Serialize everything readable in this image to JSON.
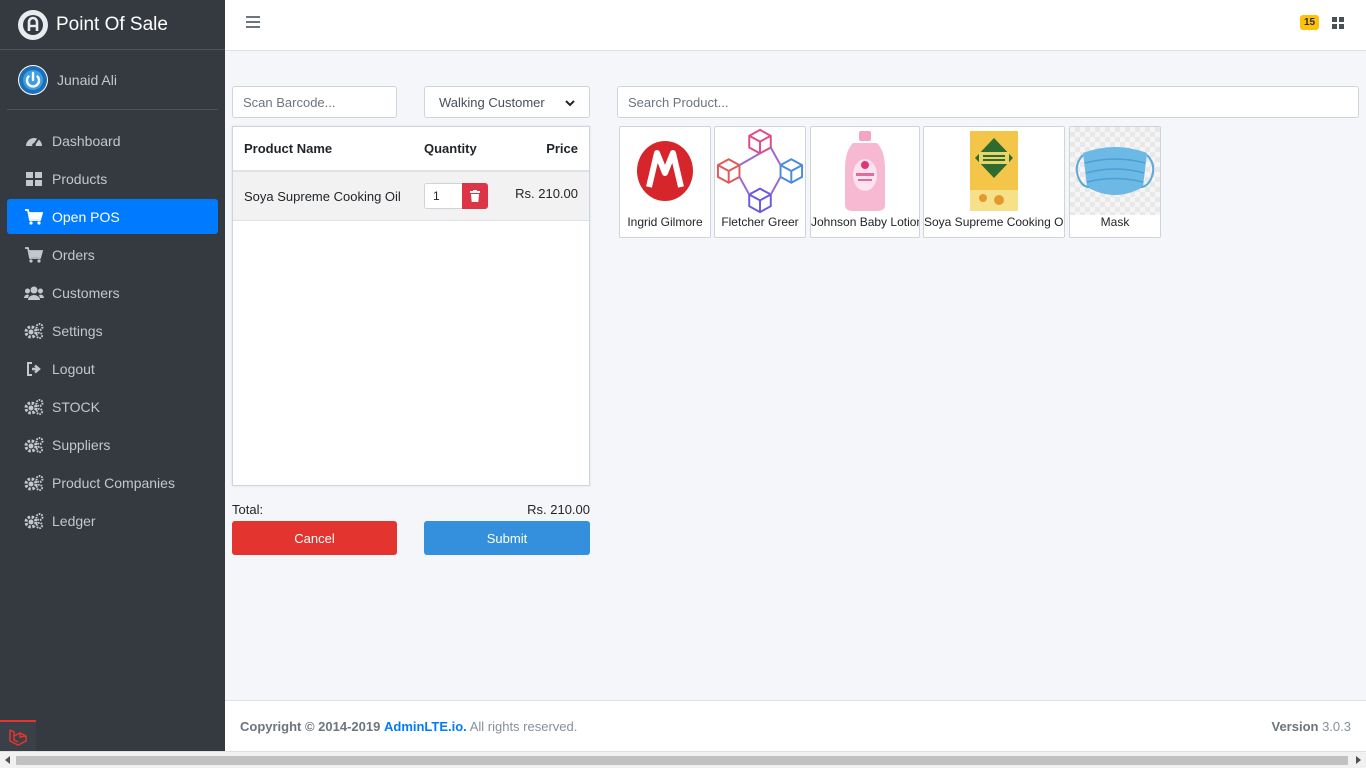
{
  "app": {
    "title": "Point Of Sale"
  },
  "user": {
    "name": "Junaid Ali"
  },
  "sidebar": {
    "items": [
      {
        "label": "Dashboard",
        "icon": "tachometer-icon"
      },
      {
        "label": "Products",
        "icon": "grid-icon"
      },
      {
        "label": "Open POS",
        "icon": "cart-icon",
        "active": true
      },
      {
        "label": "Orders",
        "icon": "cart-icon"
      },
      {
        "label": "Customers",
        "icon": "users-icon"
      },
      {
        "label": "Settings",
        "icon": "cogs-icon"
      },
      {
        "label": "Logout",
        "icon": "sign-out-icon"
      },
      {
        "label": "STOCK",
        "icon": "cogs-icon"
      },
      {
        "label": "Suppliers",
        "icon": "cogs-icon"
      },
      {
        "label": "Product Companies",
        "icon": "cogs-icon"
      },
      {
        "label": "Ledger",
        "icon": "cogs-icon"
      }
    ]
  },
  "header": {
    "notification_count": "15"
  },
  "pos": {
    "barcode_placeholder": "Scan Barcode...",
    "customer_select": "Walking Customer",
    "search_placeholder": "Search Product...",
    "cart": {
      "columns": [
        "Product Name",
        "Quantity",
        "Price"
      ],
      "rows": [
        {
          "name": "Soya Supreme Cooking Oil",
          "quantity": "1",
          "price": "Rs. 210.00"
        }
      ]
    },
    "total_label": "Total:",
    "total_value": "Rs. 210.00",
    "cancel_label": "Cancel",
    "submit_label": "Submit"
  },
  "products": [
    {
      "name": "Ingrid Gilmore"
    },
    {
      "name": "Fletcher Greer"
    },
    {
      "name": "Johnson Baby Lotion"
    },
    {
      "name": "Soya Supreme Cooking Oil"
    },
    {
      "name": "Mask"
    }
  ],
  "footer": {
    "copyright": "Copyright © 2014-2019",
    "link": "AdminLTE.io.",
    "rights": "All rights reserved.",
    "version_label": "Version",
    "version": "3.0.3"
  },
  "colors": {
    "sidebar_bg": "#343a40",
    "active": "#007bff",
    "cancel": "#dc3545",
    "submit": "#3490dc",
    "badge": "#ffc107"
  }
}
